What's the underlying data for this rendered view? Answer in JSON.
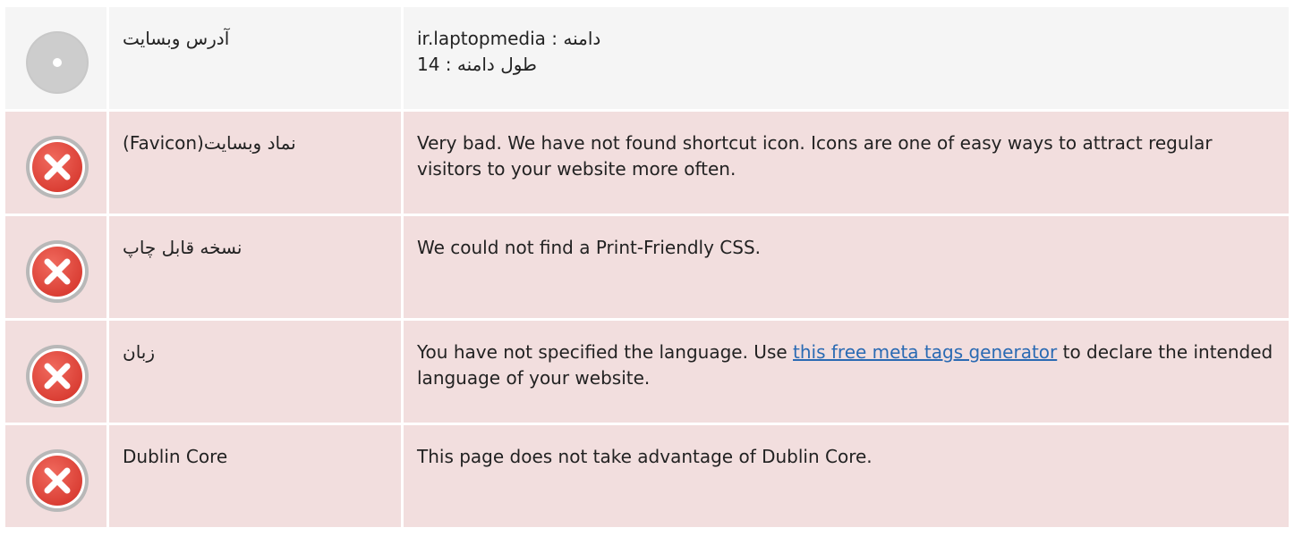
{
  "rows": [
    {
      "status": "neutral",
      "icon": "disc-icon",
      "label": "آدرس وبسایت",
      "detail_line1": "دامنه : ir.laptopmedia",
      "detail_line2": "طول دامنه : 14"
    },
    {
      "status": "bad",
      "icon": "error-x-icon",
      "label": "نماد وبسایت(Favicon)",
      "detail_text": "Very bad. We have not found shortcut icon. Icons are one of easy ways to attract regular visitors to your website more often."
    },
    {
      "status": "bad",
      "icon": "error-x-icon",
      "label": "نسخه قابل چاپ",
      "detail_text": "We could not find a Print-Friendly CSS."
    },
    {
      "status": "bad",
      "icon": "error-x-icon",
      "label": "زبان",
      "detail_before": "You have not specified the language. Use ",
      "detail_link": "this free meta tags generator",
      "detail_after": " to declare the intended language of your website."
    },
    {
      "status": "bad",
      "icon": "error-x-icon",
      "label": "Dublin Core",
      "detail_text": "This page does not take advantage of Dublin Core."
    }
  ],
  "colors": {
    "neutral_bg": "#f5f5f5",
    "bad_bg": "#f2dede",
    "error_red": "#e0473c",
    "link": "#2a6ab3",
    "disc_gray": "#c8c8c8"
  }
}
